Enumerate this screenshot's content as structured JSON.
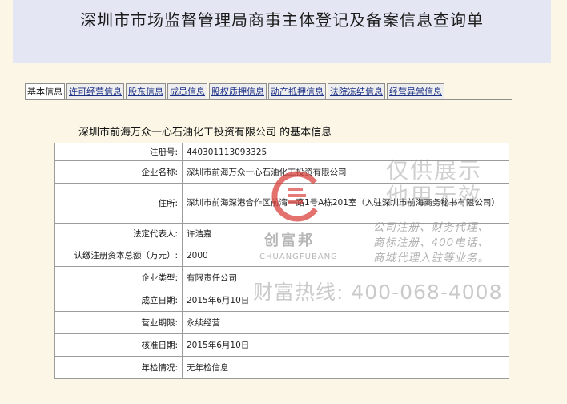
{
  "header": {
    "title": "深圳市市场监督管理局商事主体登记及备案信息查询单"
  },
  "tabs": [
    {
      "label": "基本信息",
      "active": true
    },
    {
      "label": "许可经营信息",
      "active": false
    },
    {
      "label": "股东信息",
      "active": false
    },
    {
      "label": "成员信息",
      "active": false
    },
    {
      "label": "股权质押信息",
      "active": false
    },
    {
      "label": "动产抵押信息",
      "active": false
    },
    {
      "label": "法院冻结信息",
      "active": false
    },
    {
      "label": "经营异常信息",
      "active": false
    }
  ],
  "section": {
    "title": "深圳市前海万众一心石油化工投资有限公司 的基本信息"
  },
  "rows": [
    {
      "label": "注册号:",
      "value": "440301113093325"
    },
    {
      "label": "企业名称:",
      "value": "深圳市前海万众一心石油化工投资有限公司"
    },
    {
      "label": "住所:",
      "value": "深圳市前海深港合作区前湾一路1号A栋201室（入驻深圳市前海商务秘书有限公司）"
    },
    {
      "label": "法定代表人:",
      "value": "许浩嘉"
    },
    {
      "label": "认缴注册资本总额（万元）:",
      "value": "2000"
    },
    {
      "label": "企业类型:",
      "value": "有限责任公司"
    },
    {
      "label": "成立日期:",
      "value": "2015年6月10日"
    },
    {
      "label": "营业期限:",
      "value": "永续经营"
    },
    {
      "label": "核准日期:",
      "value": "2015年6月10日"
    },
    {
      "label": "年检情况:",
      "value": "无年检信息"
    }
  ],
  "watermark": {
    "brand_cn": "创富邦",
    "brand_en": "CHUANGFUBANG",
    "demo_line1": "仅供展示",
    "demo_line2": "他用无效",
    "services_line1": "公司注册、财务代理、",
    "services_line2": "商标注册、400电话、",
    "services_line3": "商城代理入驻等业务。",
    "hotline": "财富热线: 400-068-4008",
    "logo_color": "#d9433f"
  }
}
